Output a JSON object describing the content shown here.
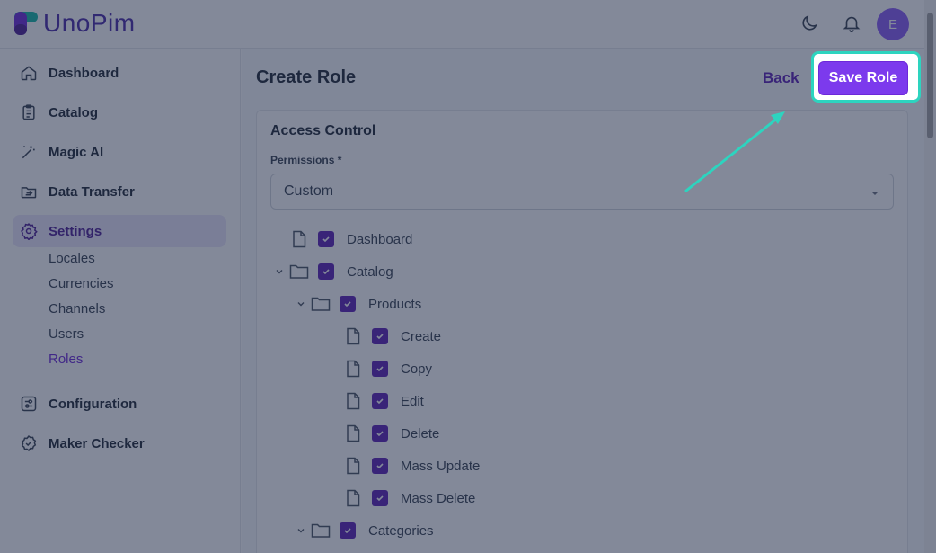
{
  "app": {
    "name": "UnoPim",
    "avatar_initial": "E"
  },
  "header": {
    "icons": [
      "moon-icon",
      "bell-icon"
    ]
  },
  "sidebar": {
    "items": [
      {
        "label": "Dashboard",
        "icon": "home-icon"
      },
      {
        "label": "Catalog",
        "icon": "clipboard-icon"
      },
      {
        "label": "Magic AI",
        "icon": "magic-wand-icon"
      },
      {
        "label": "Data Transfer",
        "icon": "transfer-icon"
      },
      {
        "label": "Settings",
        "icon": "gear-icon",
        "active": true
      },
      {
        "label": "Configuration",
        "icon": "sliders-icon"
      },
      {
        "label": "Maker Checker",
        "icon": "badge-check-icon"
      }
    ],
    "settings_sub": [
      "Locales",
      "Currencies",
      "Channels",
      "Users",
      "Roles"
    ],
    "active_sub": "Roles"
  },
  "page": {
    "title": "Create Role",
    "back_label": "Back",
    "save_label": "Save Role"
  },
  "access": {
    "title": "Access Control",
    "permissions_label": "Permissions *",
    "permissions_value": "Custom",
    "tree": [
      {
        "label": "Dashboard",
        "type": "file",
        "checked": true
      },
      {
        "label": "Catalog",
        "type": "folder",
        "checked": true,
        "expanded": true
      },
      {
        "label": "Products",
        "type": "folder",
        "checked": true,
        "expanded": true
      },
      {
        "label": "Create",
        "type": "file",
        "checked": true
      },
      {
        "label": "Copy",
        "type": "file",
        "checked": true
      },
      {
        "label": "Edit",
        "type": "file",
        "checked": true
      },
      {
        "label": "Delete",
        "type": "file",
        "checked": true
      },
      {
        "label": "Mass Update",
        "type": "file",
        "checked": true
      },
      {
        "label": "Mass Delete",
        "type": "file",
        "checked": true
      },
      {
        "label": "Categories",
        "type": "folder",
        "checked": true,
        "expanded": true
      }
    ]
  },
  "colors": {
    "accent": "#7c3aed",
    "highlight": "#2dd4bf",
    "checkbox": "#5b21b6"
  }
}
